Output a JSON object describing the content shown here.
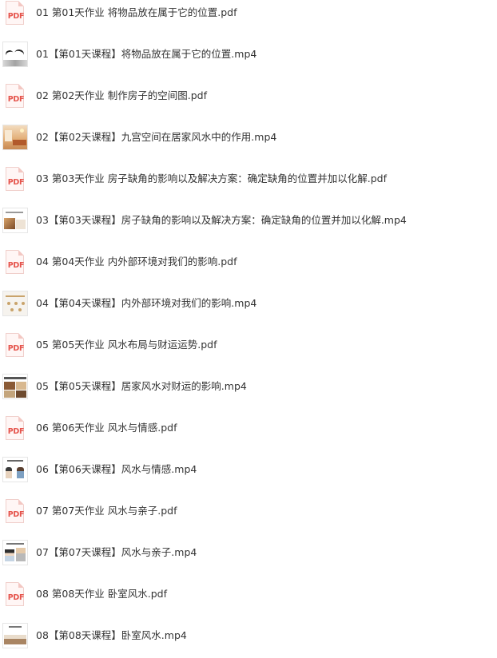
{
  "files": [
    {
      "type": "pdf",
      "icon_label": "PDF",
      "name": "01 第01天作业 将物品放在属于它的位置.pdf"
    },
    {
      "type": "mp4",
      "icon": "video-thumbnail-01",
      "name": "01【第01天课程】将物品放在属于它的位置.mp4"
    },
    {
      "type": "pdf",
      "icon_label": "PDF",
      "name": "02 第02天作业 制作房子的空间图.pdf"
    },
    {
      "type": "mp4",
      "icon": "video-thumbnail-02",
      "name": "02【第02天课程】九宫空间在居家风水中的作用.mp4"
    },
    {
      "type": "pdf",
      "icon_label": "PDF",
      "name": "03 第03天作业 房子缺角的影响以及解决方案：确定缺角的位置并加以化解.pdf"
    },
    {
      "type": "mp4",
      "icon": "video-thumbnail-03",
      "name": "03【第03天课程】房子缺角的影响以及解决方案：确定缺角的位置并加以化解.mp4"
    },
    {
      "type": "pdf",
      "icon_label": "PDF",
      "name": "04 第04天作业 内外部环境对我们的影响.pdf"
    },
    {
      "type": "mp4",
      "icon": "video-thumbnail-04",
      "name": "04【第04天课程】内外部环境对我们的影响.mp4"
    },
    {
      "type": "pdf",
      "icon_label": "PDF",
      "name": "05 第05天作业 风水布局与财运运势.pdf"
    },
    {
      "type": "mp4",
      "icon": "video-thumbnail-05",
      "name": "05【第05天课程】居家风水对财运的影响.mp4"
    },
    {
      "type": "pdf",
      "icon_label": "PDF",
      "name": "06 第06天作业 风水与情感.pdf"
    },
    {
      "type": "mp4",
      "icon": "video-thumbnail-06",
      "name": "06【第06天课程】风水与情感.mp4"
    },
    {
      "type": "pdf",
      "icon_label": "PDF",
      "name": "07 第07天作业 风水与亲子.pdf"
    },
    {
      "type": "mp4",
      "icon": "video-thumbnail-07",
      "name": "07【第07天课程】风水与亲子.mp4"
    },
    {
      "type": "pdf",
      "icon_label": "PDF",
      "name": "08 第08天作业 卧室风水.pdf"
    },
    {
      "type": "mp4",
      "icon": "video-thumbnail-08",
      "name": "08【第08天课程】卧室风水.mp4"
    }
  ],
  "colors": {
    "text": "#333333",
    "pdf_red": "#e5534b",
    "background": "#ffffff"
  }
}
